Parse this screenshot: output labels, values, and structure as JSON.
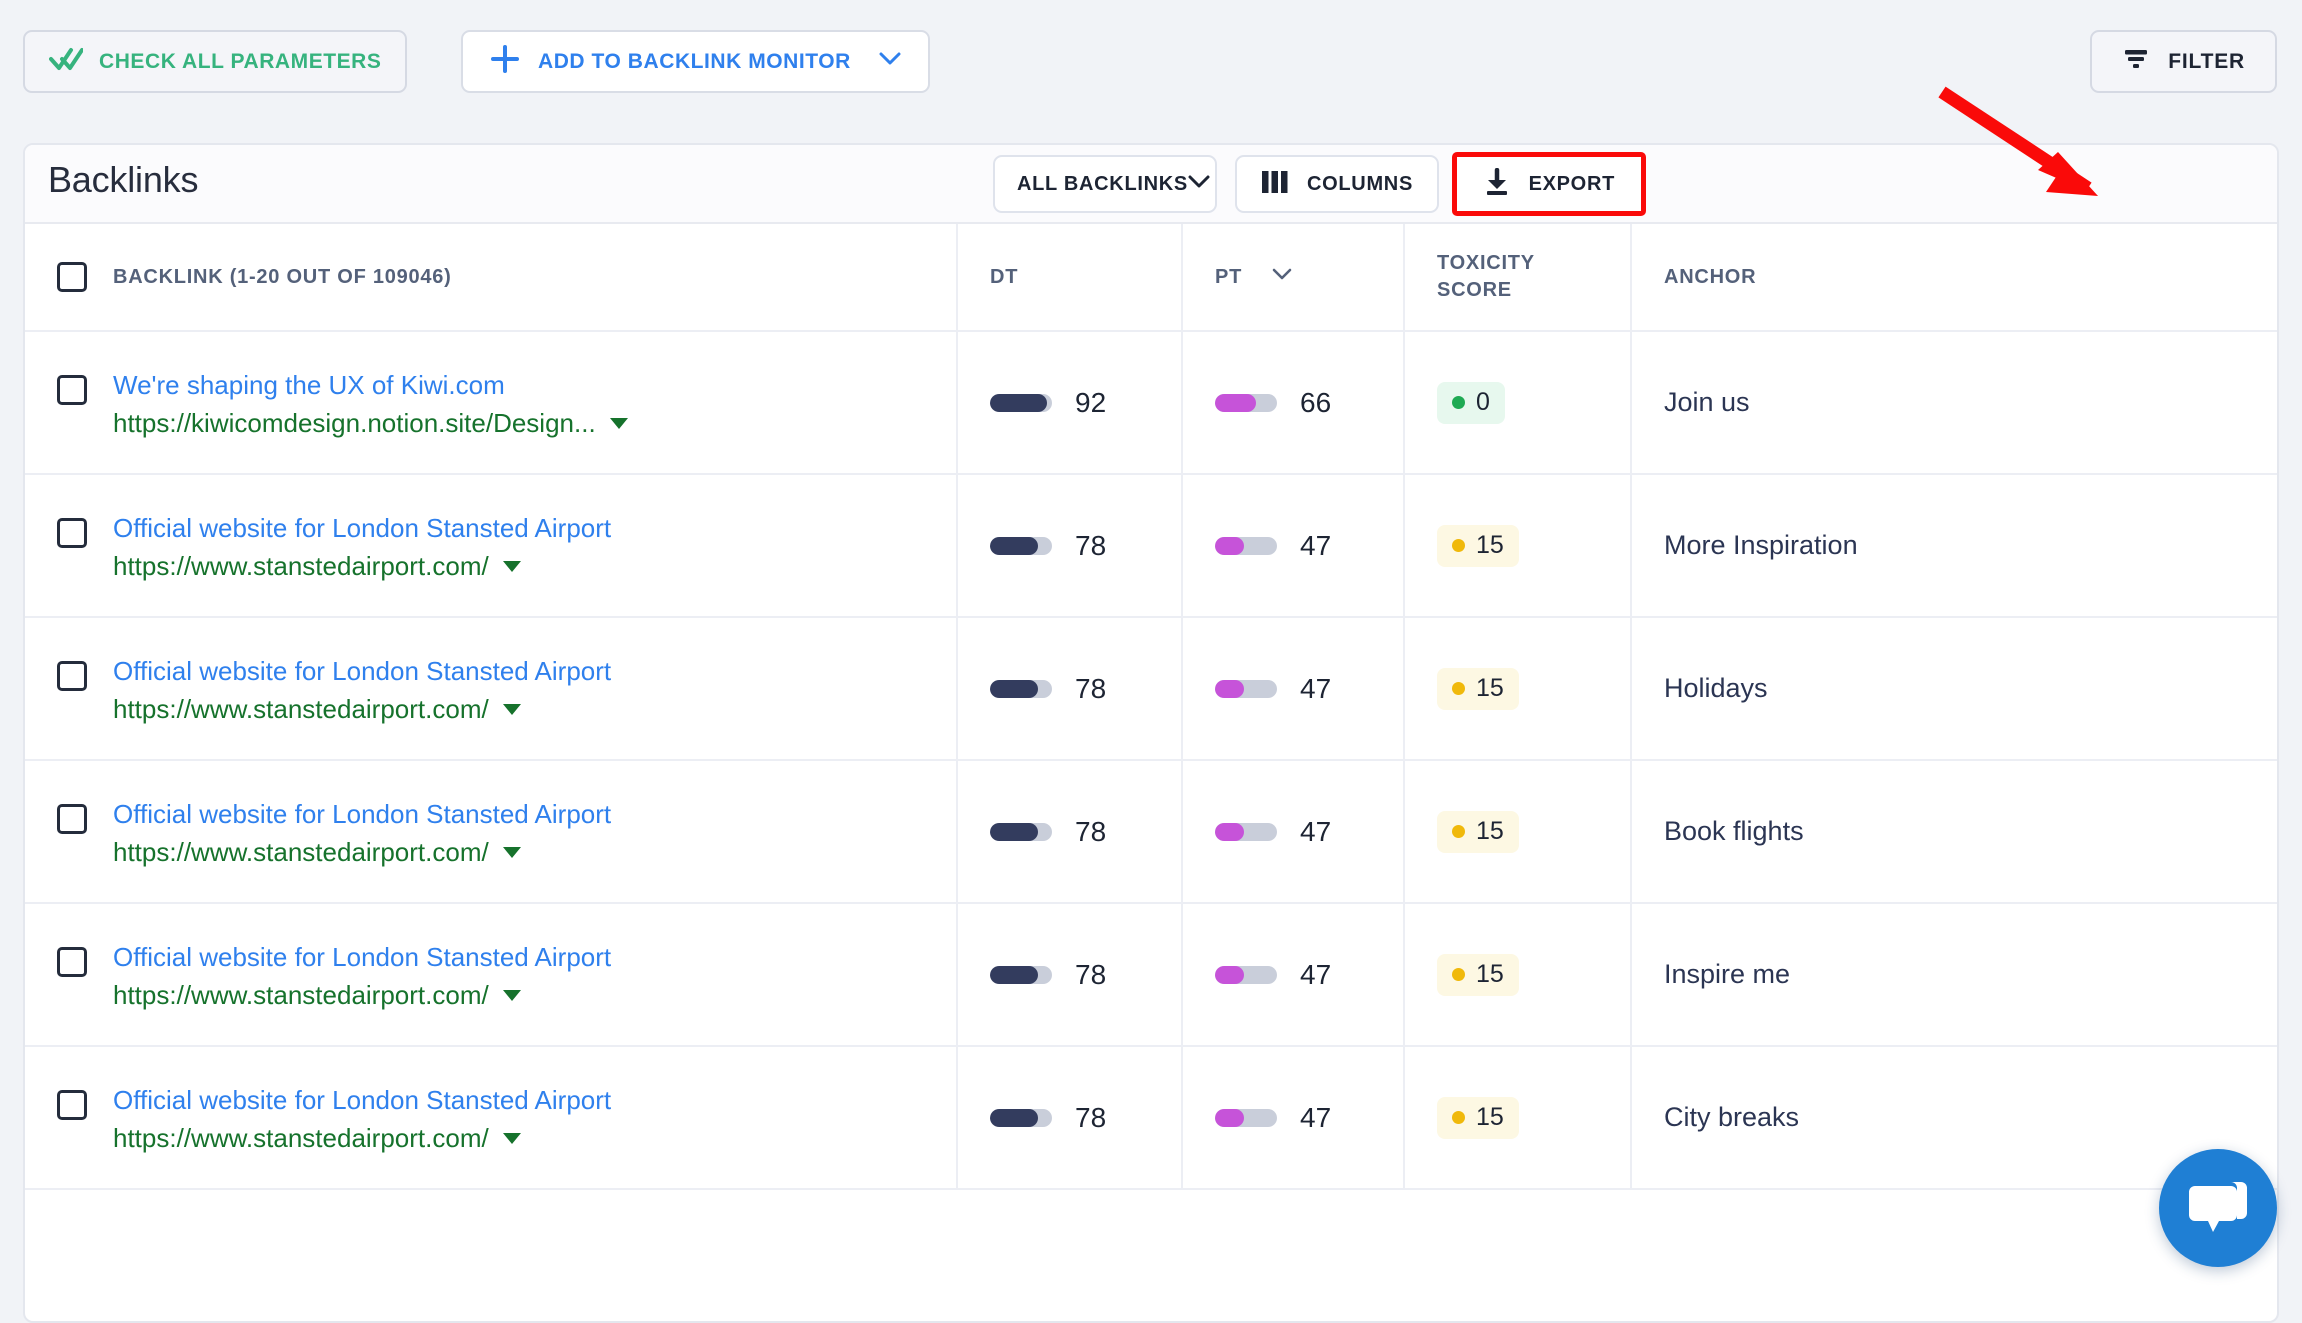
{
  "toolbar": {
    "check_all_label": "CHECK ALL PARAMETERS",
    "add_monitor_label": "ADD TO BACKLINK MONITOR",
    "filter_label": "FILTER",
    "check_icon": "double-check-icon",
    "plus_icon": "plus-icon",
    "chevron_icon": "chevron-down-icon",
    "filter_icon": "filter-icon",
    "accent_green": "#36b37e",
    "accent_blue": "#2f80ed"
  },
  "card": {
    "title": "Backlinks",
    "controls": {
      "scope_label": "ALL BACKLINKS",
      "columns_label": "COLUMNS",
      "export_label": "EXPORT",
      "columns_icon": "columns-icon",
      "export_icon": "download-icon",
      "scope_chevron_icon": "chevron-down-icon",
      "export_highlight_color": "#fa0a09"
    }
  },
  "table": {
    "headers": {
      "backlink": "BACKLINK (1-20 OUT OF 109046)",
      "dt": "DT",
      "pt": "PT",
      "toxicity": "TOXICITY SCORE",
      "anchor": "ANCHOR"
    },
    "sorted_column": "PT",
    "sort_icon": "chevron-down-icon",
    "rows": [
      {
        "title": "We're shaping the UX of Kiwi.com",
        "url": "https://kiwicomdesign.notion.site/Design...",
        "dt": 92,
        "pt": 66,
        "toxicity": 0,
        "toxicity_level": "green",
        "anchor": "Join us",
        "checked": false
      },
      {
        "title": "Official website for London Stansted Airport",
        "url": "https://www.stanstedairport.com/",
        "dt": 78,
        "pt": 47,
        "toxicity": 15,
        "toxicity_level": "yellow",
        "anchor": "More Inspiration",
        "checked": false
      },
      {
        "title": "Official website for London Stansted Airport",
        "url": "https://www.stanstedairport.com/",
        "dt": 78,
        "pt": 47,
        "toxicity": 15,
        "toxicity_level": "yellow",
        "anchor": "Holidays",
        "checked": false
      },
      {
        "title": "Official website for London Stansted Airport",
        "url": "https://www.stanstedairport.com/",
        "dt": 78,
        "pt": 47,
        "toxicity": 15,
        "toxicity_level": "yellow",
        "anchor": "Book flights",
        "checked": false
      },
      {
        "title": "Official website for London Stansted Airport",
        "url": "https://www.stanstedairport.com/",
        "dt": 78,
        "pt": 47,
        "toxicity": 15,
        "toxicity_level": "yellow",
        "anchor": "Inspire me",
        "checked": false
      },
      {
        "title": "Official website for London Stansted Airport",
        "url": "https://www.stanstedairport.com/",
        "dt": 78,
        "pt": 47,
        "toxicity": 15,
        "toxicity_level": "yellow",
        "anchor": "City breaks",
        "checked": false
      }
    ]
  },
  "chat_widget": {
    "icon": "chat-bubble-icon",
    "color": "#1f7fd4"
  },
  "annotation": {
    "type": "arrow",
    "color": "#fa0a09",
    "points_to": "EXPORT"
  }
}
